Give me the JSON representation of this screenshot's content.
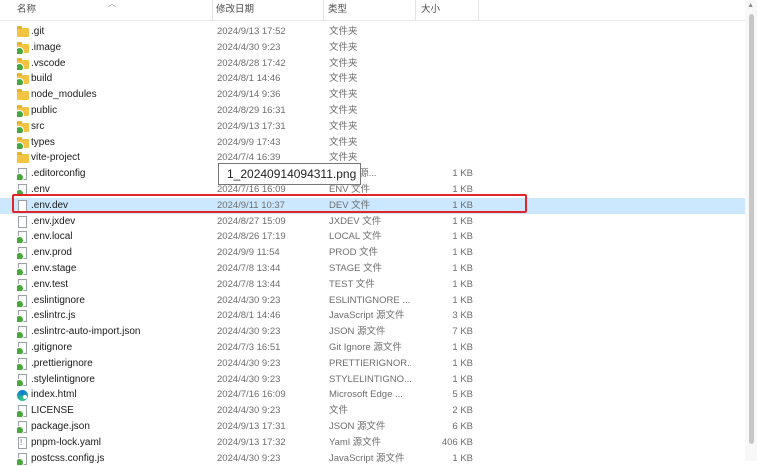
{
  "columns": {
    "name": "名称",
    "date": "修改日期",
    "type": "类型",
    "size": "大小"
  },
  "tooltip": "1_20240914094311.png",
  "selected_index": 12,
  "files": [
    {
      "name": ".git",
      "date": "2024/9/13 17:52",
      "type": "文件夹",
      "size": "",
      "icon": "folder-icon"
    },
    {
      "name": ".image",
      "date": "2024/4/30 9:23",
      "type": "文件夹",
      "size": "",
      "icon": "folder-synced-icon"
    },
    {
      "name": ".vscode",
      "date": "2024/8/28 17:42",
      "type": "文件夹",
      "size": "",
      "icon": "folder-synced-icon"
    },
    {
      "name": "build",
      "date": "2024/8/1 14:46",
      "type": "文件夹",
      "size": "",
      "icon": "folder-synced-icon"
    },
    {
      "name": "node_modules",
      "date": "2024/9/14 9:36",
      "type": "文件夹",
      "size": "",
      "icon": "folder-icon"
    },
    {
      "name": "public",
      "date": "2024/8/29 16:31",
      "type": "文件夹",
      "size": "",
      "icon": "folder-synced-icon"
    },
    {
      "name": "src",
      "date": "2024/9/13 17:31",
      "type": "文件夹",
      "size": "",
      "icon": "folder-synced-icon"
    },
    {
      "name": "types",
      "date": "2024/9/9 17:43",
      "type": "文件夹",
      "size": "",
      "icon": "folder-synced-icon"
    },
    {
      "name": "vite-project",
      "date": "2024/7/4 16:39",
      "type": "文件夹",
      "size": "",
      "icon": "folder-icon"
    },
    {
      "name": ".editorconfig",
      "date": "",
      "type": "Config 源...",
      "size": "1 KB",
      "icon": "file-synced-icon"
    },
    {
      "name": ".env",
      "date": "2024/7/16 16:09",
      "type": "ENV 文件",
      "size": "1 KB",
      "icon": "file-synced-icon"
    },
    {
      "name": ".env.dev",
      "date": "2024/9/11 10:37",
      "type": "DEV 文件",
      "size": "1 KB",
      "icon": "file-icon"
    },
    {
      "name": ".env.jxdev",
      "date": "2024/8/27 15:09",
      "type": "JXDEV 文件",
      "size": "1 KB",
      "icon": "file-icon"
    },
    {
      "name": ".env.local",
      "date": "2024/8/26 17:19",
      "type": "LOCAL 文件",
      "size": "1 KB",
      "icon": "file-synced-icon"
    },
    {
      "name": ".env.prod",
      "date": "2024/9/9 11:54",
      "type": "PROD 文件",
      "size": "1 KB",
      "icon": "file-synced-icon"
    },
    {
      "name": ".env.stage",
      "date": "2024/7/8 13:44",
      "type": "STAGE 文件",
      "size": "1 KB",
      "icon": "file-synced-icon"
    },
    {
      "name": ".env.test",
      "date": "2024/7/8 13:44",
      "type": "TEST 文件",
      "size": "1 KB",
      "icon": "file-synced-icon"
    },
    {
      "name": ".eslintignore",
      "date": "2024/4/30 9:23",
      "type": "ESLINTIGNORE ...",
      "size": "1 KB",
      "icon": "file-synced-icon"
    },
    {
      "name": ".eslintrc.js",
      "date": "2024/8/1 14:46",
      "type": "JavaScript 源文件",
      "size": "3 KB",
      "icon": "file-synced-icon"
    },
    {
      "name": ".eslintrc-auto-import.json",
      "date": "2024/4/30 9:23",
      "type": "JSON 源文件",
      "size": "7 KB",
      "icon": "file-synced-icon"
    },
    {
      "name": ".gitignore",
      "date": "2024/7/3 16:51",
      "type": "Git Ignore 源文件",
      "size": "1 KB",
      "icon": "file-synced-icon"
    },
    {
      "name": ".prettierignore",
      "date": "2024/4/30 9:23",
      "type": "PRETTIERIGNOR...",
      "size": "1 KB",
      "icon": "file-synced-icon"
    },
    {
      "name": ".stylelintignore",
      "date": "2024/4/30 9:23",
      "type": "STYLELINTIGNO...",
      "size": "1 KB",
      "icon": "file-synced-icon"
    },
    {
      "name": "index.html",
      "date": "2024/7/16 16:09",
      "type": "Microsoft Edge ...",
      "size": "5 KB",
      "icon": "edge-html-icon"
    },
    {
      "name": "LICENSE",
      "date": "2024/4/30 9:23",
      "type": "文件",
      "size": "2 KB",
      "icon": "file-synced-icon"
    },
    {
      "name": "package.json",
      "date": "2024/9/13 17:31",
      "type": "JSON 源文件",
      "size": "6 KB",
      "icon": "file-synced-icon"
    },
    {
      "name": "pnpm-lock.yaml",
      "date": "2024/9/13 17:32",
      "type": "Yaml 源文件",
      "size": "406 KB",
      "icon": "yaml-file-icon"
    },
    {
      "name": "postcss.config.js",
      "date": "2024/4/30 9:23",
      "type": "JavaScript 源文件",
      "size": "1 KB",
      "icon": "file-synced-icon"
    }
  ]
}
